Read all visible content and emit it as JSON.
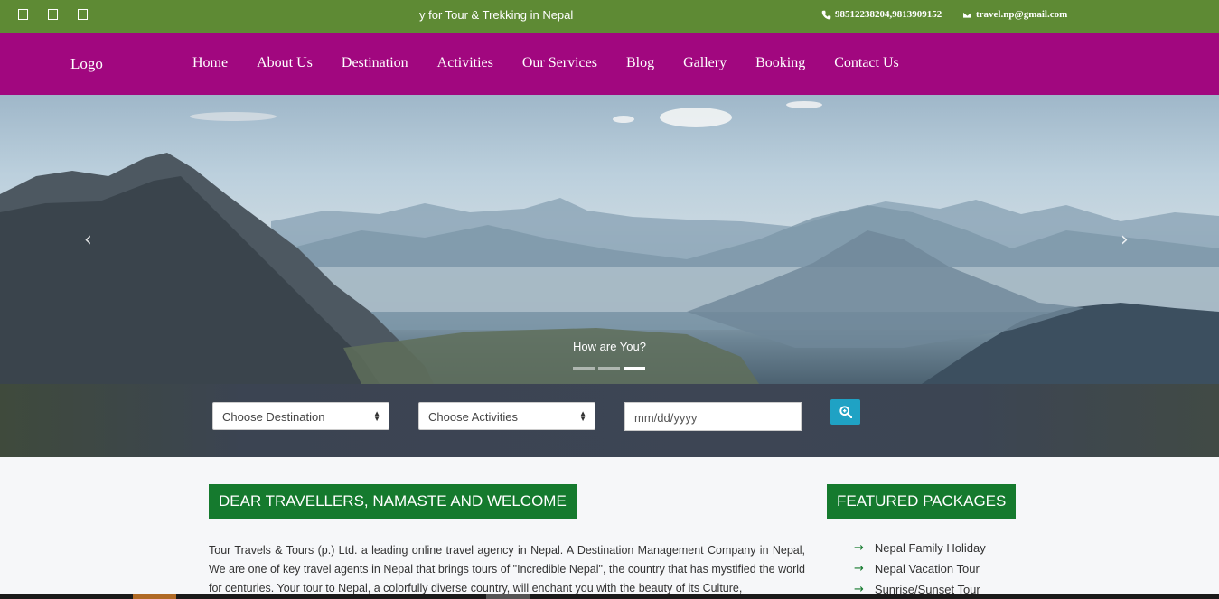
{
  "topbar": {
    "social_icons": [
      "facebook-icon",
      "twitter-icon",
      "instagram-icon"
    ],
    "marquee_text": "y for Tour & Trekking in Nepal",
    "phone": "98512238204,9813909152",
    "email": "travel.np@gmail.com"
  },
  "nav": {
    "logo": "Logo",
    "items": [
      "Home",
      "About Us",
      "Destination",
      "Activities",
      "Our Services",
      "Blog",
      "Gallery",
      "Booking",
      "Contact Us"
    ]
  },
  "hero": {
    "caption": "How are You?",
    "slides": 3,
    "active_slide": 3
  },
  "search": {
    "destination_placeholder": "Choose Destination",
    "activities_placeholder": "Choose Activities",
    "date_placeholder": "mm/dd/yyyy"
  },
  "welcome": {
    "heading": "DEAR TRAVELLERS, NAMASTE AND WELCOME",
    "paragraph": "Tour Travels & Tours (p.) Ltd. a leading online travel agency in Nepal. A Destination Management Company in Nepal, We are one of key travel agents in Nepal that brings tours of \"Incredible Nepal\", the country that has mystified the world for centuries. Your tour to Nepal, a colorfully diverse country, will enchant you with the beauty of its Culture,"
  },
  "featured": {
    "heading": "FEATURED PACKAGES",
    "packages": [
      "Nepal Family Holiday",
      "Nepal Vacation Tour",
      "Sunrise/Sunset Tour"
    ]
  },
  "colors": {
    "topbar": "#5e8a34",
    "navbar": "#a1077f",
    "heading_green": "#157a2e",
    "search_button": "#1fa2c4"
  }
}
